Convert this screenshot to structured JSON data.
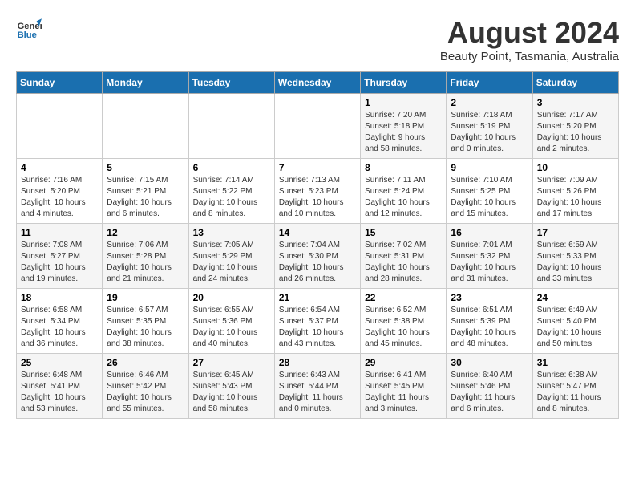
{
  "header": {
    "logo_general": "General",
    "logo_blue": "Blue",
    "title": "August 2024",
    "location": "Beauty Point, Tasmania, Australia"
  },
  "calendar": {
    "days_of_week": [
      "Sunday",
      "Monday",
      "Tuesday",
      "Wednesday",
      "Thursday",
      "Friday",
      "Saturday"
    ],
    "weeks": [
      [
        {
          "day": "",
          "info": ""
        },
        {
          "day": "",
          "info": ""
        },
        {
          "day": "",
          "info": ""
        },
        {
          "day": "",
          "info": ""
        },
        {
          "day": "1",
          "info": "Sunrise: 7:20 AM\nSunset: 5:18 PM\nDaylight: 9 hours\nand 58 minutes."
        },
        {
          "day": "2",
          "info": "Sunrise: 7:18 AM\nSunset: 5:19 PM\nDaylight: 10 hours\nand 0 minutes."
        },
        {
          "day": "3",
          "info": "Sunrise: 7:17 AM\nSunset: 5:20 PM\nDaylight: 10 hours\nand 2 minutes."
        }
      ],
      [
        {
          "day": "4",
          "info": "Sunrise: 7:16 AM\nSunset: 5:20 PM\nDaylight: 10 hours\nand 4 minutes."
        },
        {
          "day": "5",
          "info": "Sunrise: 7:15 AM\nSunset: 5:21 PM\nDaylight: 10 hours\nand 6 minutes."
        },
        {
          "day": "6",
          "info": "Sunrise: 7:14 AM\nSunset: 5:22 PM\nDaylight: 10 hours\nand 8 minutes."
        },
        {
          "day": "7",
          "info": "Sunrise: 7:13 AM\nSunset: 5:23 PM\nDaylight: 10 hours\nand 10 minutes."
        },
        {
          "day": "8",
          "info": "Sunrise: 7:11 AM\nSunset: 5:24 PM\nDaylight: 10 hours\nand 12 minutes."
        },
        {
          "day": "9",
          "info": "Sunrise: 7:10 AM\nSunset: 5:25 PM\nDaylight: 10 hours\nand 15 minutes."
        },
        {
          "day": "10",
          "info": "Sunrise: 7:09 AM\nSunset: 5:26 PM\nDaylight: 10 hours\nand 17 minutes."
        }
      ],
      [
        {
          "day": "11",
          "info": "Sunrise: 7:08 AM\nSunset: 5:27 PM\nDaylight: 10 hours\nand 19 minutes."
        },
        {
          "day": "12",
          "info": "Sunrise: 7:06 AM\nSunset: 5:28 PM\nDaylight: 10 hours\nand 21 minutes."
        },
        {
          "day": "13",
          "info": "Sunrise: 7:05 AM\nSunset: 5:29 PM\nDaylight: 10 hours\nand 24 minutes."
        },
        {
          "day": "14",
          "info": "Sunrise: 7:04 AM\nSunset: 5:30 PM\nDaylight: 10 hours\nand 26 minutes."
        },
        {
          "day": "15",
          "info": "Sunrise: 7:02 AM\nSunset: 5:31 PM\nDaylight: 10 hours\nand 28 minutes."
        },
        {
          "day": "16",
          "info": "Sunrise: 7:01 AM\nSunset: 5:32 PM\nDaylight: 10 hours\nand 31 minutes."
        },
        {
          "day": "17",
          "info": "Sunrise: 6:59 AM\nSunset: 5:33 PM\nDaylight: 10 hours\nand 33 minutes."
        }
      ],
      [
        {
          "day": "18",
          "info": "Sunrise: 6:58 AM\nSunset: 5:34 PM\nDaylight: 10 hours\nand 36 minutes."
        },
        {
          "day": "19",
          "info": "Sunrise: 6:57 AM\nSunset: 5:35 PM\nDaylight: 10 hours\nand 38 minutes."
        },
        {
          "day": "20",
          "info": "Sunrise: 6:55 AM\nSunset: 5:36 PM\nDaylight: 10 hours\nand 40 minutes."
        },
        {
          "day": "21",
          "info": "Sunrise: 6:54 AM\nSunset: 5:37 PM\nDaylight: 10 hours\nand 43 minutes."
        },
        {
          "day": "22",
          "info": "Sunrise: 6:52 AM\nSunset: 5:38 PM\nDaylight: 10 hours\nand 45 minutes."
        },
        {
          "day": "23",
          "info": "Sunrise: 6:51 AM\nSunset: 5:39 PM\nDaylight: 10 hours\nand 48 minutes."
        },
        {
          "day": "24",
          "info": "Sunrise: 6:49 AM\nSunset: 5:40 PM\nDaylight: 10 hours\nand 50 minutes."
        }
      ],
      [
        {
          "day": "25",
          "info": "Sunrise: 6:48 AM\nSunset: 5:41 PM\nDaylight: 10 hours\nand 53 minutes."
        },
        {
          "day": "26",
          "info": "Sunrise: 6:46 AM\nSunset: 5:42 PM\nDaylight: 10 hours\nand 55 minutes."
        },
        {
          "day": "27",
          "info": "Sunrise: 6:45 AM\nSunset: 5:43 PM\nDaylight: 10 hours\nand 58 minutes."
        },
        {
          "day": "28",
          "info": "Sunrise: 6:43 AM\nSunset: 5:44 PM\nDaylight: 11 hours\nand 0 minutes."
        },
        {
          "day": "29",
          "info": "Sunrise: 6:41 AM\nSunset: 5:45 PM\nDaylight: 11 hours\nand 3 minutes."
        },
        {
          "day": "30",
          "info": "Sunrise: 6:40 AM\nSunset: 5:46 PM\nDaylight: 11 hours\nand 6 minutes."
        },
        {
          "day": "31",
          "info": "Sunrise: 6:38 AM\nSunset: 5:47 PM\nDaylight: 11 hours\nand 8 minutes."
        }
      ]
    ]
  }
}
